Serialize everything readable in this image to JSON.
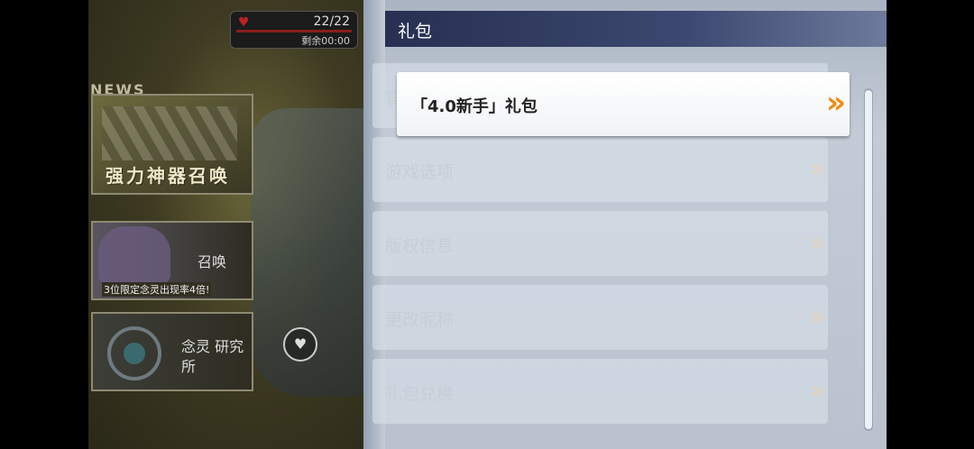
{
  "game": {
    "stamina": {
      "count": "22/22",
      "timer": "剩余00:00"
    },
    "news_label": "NEWS",
    "banners": [
      {
        "title": "强力神器召唤"
      },
      {
        "title": "召唤",
        "note": "3位限定念灵出现率4倍!"
      },
      {
        "title": "念灵 研究所"
      }
    ]
  },
  "panel": {
    "title": "礼包",
    "selected_item": "「4.0新手」礼包",
    "items": [
      {
        "label": "官"
      },
      {
        "label": "游戏选项"
      },
      {
        "label": "版权信息"
      },
      {
        "label": "更改昵称"
      },
      {
        "label": "礼包兑换"
      }
    ],
    "chevron": "»"
  },
  "colors": {
    "accent": "#f28a0f",
    "header": "#273052"
  }
}
